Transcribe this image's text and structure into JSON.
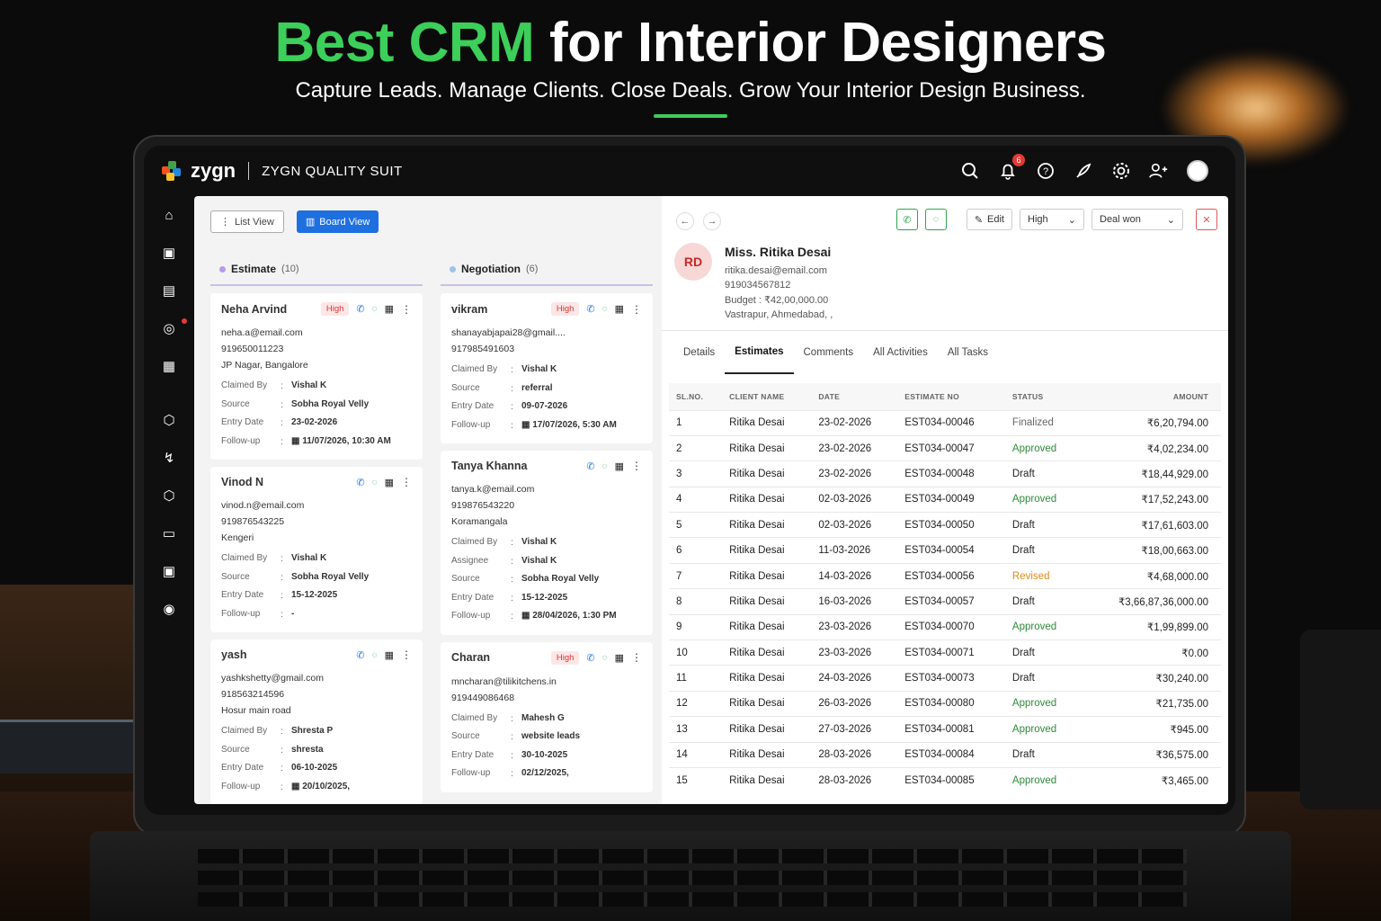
{
  "hero": {
    "title_accent": "Best CRM",
    "title_rest": " for Interior Designers",
    "subtitle": "Capture Leads. Manage Clients. Close Deals. Grow Your Interior Design Business."
  },
  "app": {
    "logo": "zygn",
    "suite": "ZYGN QUALITY SUIT",
    "notifications": "6"
  },
  "views": {
    "list": "List View",
    "board": "Board View"
  },
  "columns": [
    {
      "name": "Estimate",
      "count": "(10)",
      "cards": [
        {
          "name": "Neha Arvind",
          "priority": "High",
          "email": "neha.a@email.com",
          "phone": "919650011223",
          "location": "JP Nagar, Bangalore",
          "fields": [
            [
              "Claimed By",
              "Vishal K"
            ],
            [
              "Source",
              "Sobha Royal Velly"
            ],
            [
              "Entry Date",
              "23-02-2026"
            ],
            [
              "Follow-up",
              "▦ 11/07/2026, 10:30 AM"
            ]
          ]
        },
        {
          "name": "Vinod N",
          "priority": "",
          "email": "vinod.n@email.com",
          "phone": "919876543225",
          "location": "Kengeri",
          "fields": [
            [
              "Claimed By",
              "Vishal K"
            ],
            [
              "Source",
              "Sobha Royal Velly"
            ],
            [
              "Entry Date",
              "15-12-2025"
            ],
            [
              "Follow-up",
              "-"
            ]
          ]
        },
        {
          "name": "yash",
          "priority": "",
          "email": "yashkshetty@gmail.com",
          "phone": "918563214596",
          "location": "Hosur main road",
          "fields": [
            [
              "Claimed By",
              "Shresta P"
            ],
            [
              "Source",
              "shresta"
            ],
            [
              "Entry Date",
              "06-10-2025"
            ],
            [
              "Follow-up",
              "▦ 20/10/2025,"
            ]
          ]
        }
      ]
    },
    {
      "name": "Negotiation",
      "count": "(6)",
      "cards": [
        {
          "name": "vikram",
          "priority": "High",
          "email": "shanayabjapai28@gmail....",
          "phone": "917985491603",
          "location": "",
          "fields": [
            [
              "Claimed By",
              "Vishal K"
            ],
            [
              "Source",
              "referral"
            ],
            [
              "Entry Date",
              "09-07-2026"
            ],
            [
              "Follow-up",
              "▦ 17/07/2026, 5:30 AM"
            ]
          ]
        },
        {
          "name": "Tanya Khanna",
          "priority": "",
          "email": "tanya.k@email.com",
          "phone": "919876543220",
          "location": "Koramangala",
          "fields": [
            [
              "Claimed By",
              "Vishal K"
            ],
            [
              "Assignee",
              "Vishal K"
            ],
            [
              "Source",
              "Sobha Royal Velly"
            ],
            [
              "Entry Date",
              "15-12-2025"
            ],
            [
              "Follow-up",
              "▦ 28/04/2026, 1:30 PM"
            ]
          ]
        },
        {
          "name": "Charan",
          "priority": "High",
          "email": "mncharan@tilikitchens.in",
          "phone": "919449086468",
          "location": "",
          "fields": [
            [
              "Claimed By",
              "Mahesh G"
            ],
            [
              "Source",
              "website leads"
            ],
            [
              "Entry Date",
              "30-10-2025"
            ],
            [
              "Follow-up",
              "02/12/2025,"
            ]
          ]
        }
      ]
    }
  ],
  "client": {
    "initials": "RD",
    "name": "Miss. Ritika Desai",
    "email": "ritika.desai@email.com",
    "phone": "919034567812",
    "budget": "Budget : ₹42,00,000.00",
    "address": "Vastrapur, Ahmedabad, ,",
    "edit": "Edit",
    "priority": "High",
    "stage": "Deal won"
  },
  "tabs": [
    "Details",
    "Estimates",
    "Comments",
    "All Activities",
    "All Tasks"
  ],
  "table": {
    "headers": [
      "SL.NO.",
      "CLIENT NAME",
      "DATE",
      "ESTIMATE NO",
      "STATUS",
      "AMOUNT"
    ],
    "rows": [
      [
        "1",
        "Ritika Desai",
        "23-02-2026",
        "EST034-00046",
        "Finalized",
        "₹6,20,794.00"
      ],
      [
        "2",
        "Ritika Desai",
        "23-02-2026",
        "EST034-00047",
        "Approved",
        "₹4,02,234.00"
      ],
      [
        "3",
        "Ritika Desai",
        "23-02-2026",
        "EST034-00048",
        "Draft",
        "₹18,44,929.00"
      ],
      [
        "4",
        "Ritika Desai",
        "02-03-2026",
        "EST034-00049",
        "Approved",
        "₹17,52,243.00"
      ],
      [
        "5",
        "Ritika Desai",
        "02-03-2026",
        "EST034-00050",
        "Draft",
        "₹17,61,603.00"
      ],
      [
        "6",
        "Ritika Desai",
        "11-03-2026",
        "EST034-00054",
        "Draft",
        "₹18,00,663.00"
      ],
      [
        "7",
        "Ritika Desai",
        "14-03-2026",
        "EST034-00056",
        "Revised",
        "₹4,68,000.00"
      ],
      [
        "8",
        "Ritika Desai",
        "16-03-2026",
        "EST034-00057",
        "Draft",
        "₹3,66,87,36,000.00"
      ],
      [
        "9",
        "Ritika Desai",
        "23-03-2026",
        "EST034-00070",
        "Approved",
        "₹1,99,899.00"
      ],
      [
        "10",
        "Ritika Desai",
        "23-03-2026",
        "EST034-00071",
        "Draft",
        "₹0.00"
      ],
      [
        "11",
        "Ritika Desai",
        "24-03-2026",
        "EST034-00073",
        "Draft",
        "₹30,240.00"
      ],
      [
        "12",
        "Ritika Desai",
        "26-03-2026",
        "EST034-00080",
        "Approved",
        "₹21,735.00"
      ],
      [
        "13",
        "Ritika Desai",
        "27-03-2026",
        "EST034-00081",
        "Approved",
        "₹945.00"
      ],
      [
        "14",
        "Ritika Desai",
        "28-03-2026",
        "EST034-00084",
        "Draft",
        "₹36,575.00"
      ],
      [
        "15",
        "Ritika Desai",
        "28-03-2026",
        "EST034-00085",
        "Approved",
        "₹3,465.00"
      ]
    ]
  },
  "colors": {
    "accent_green": "#3ccf5a",
    "primary_blue": "#1e6fe0",
    "high": "#d33333"
  }
}
